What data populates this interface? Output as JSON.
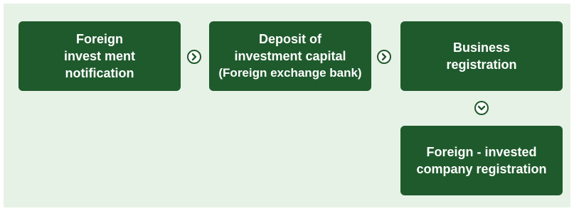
{
  "steps": [
    {
      "lines": [
        "Foreign",
        "invest ment",
        "notification"
      ]
    },
    {
      "lines": [
        "Deposit of",
        "investment capital",
        "(Foreign exchange bank)"
      ]
    },
    {
      "lines": [
        "Business",
        "registration"
      ]
    },
    {
      "lines": [
        "Foreign - invested",
        "company registration"
      ]
    }
  ],
  "arrows": [
    "chevron-right-icon",
    "chevron-right-icon",
    "chevron-down-icon"
  ],
  "colors": {
    "box": "#1f5a2c",
    "panel": "#e6f2e6",
    "text": "#ffffff"
  }
}
